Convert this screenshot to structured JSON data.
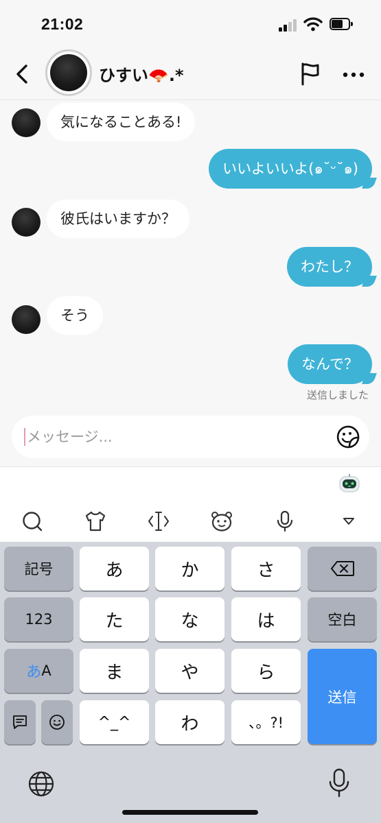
{
  "status_bar": {
    "time": "21:02",
    "icons": [
      "signal-icon",
      "wifi-icon",
      "battery-icon"
    ]
  },
  "header": {
    "contact_name": "ひすい🪭.*",
    "icons": [
      "back-arrow-icon",
      "avatar",
      "flag-icon",
      "more-icon"
    ]
  },
  "messages": [
    {
      "side": "in",
      "text": "気になることある!"
    },
    {
      "side": "out",
      "text": "いいよいいよ(๑˘ᵕ˘๑)"
    },
    {
      "side": "in",
      "text": "彼氏はいますか？"
    },
    {
      "side": "out",
      "text": "わたし？"
    },
    {
      "side": "in",
      "text": "そう"
    },
    {
      "side": "out",
      "text": "なんで？"
    }
  ],
  "sent_status": "送信しました",
  "input": {
    "placeholder": "メッセージ...",
    "value": ""
  },
  "keyboard_toolbar": {
    "icons": [
      "chat-search-icon",
      "shirt-icon",
      "cursor-move-icon",
      "bear-face-icon",
      "microphone-icon",
      "collapse-triangle-icon",
      "robot-icon"
    ]
  },
  "keyboard": {
    "symbols": "記号",
    "numbers": "123",
    "kana_mode": "あ",
    "alpha_mode": "A",
    "space": "空白",
    "send": "送信",
    "keys": [
      "あ",
      "か",
      "さ",
      "た",
      "な",
      "は",
      "ま",
      "や",
      "ら",
      "^_^",
      "わ",
      "、。?!"
    ],
    "icons": [
      "backspace-icon",
      "message-icon",
      "emoji-icon",
      "globe-icon",
      "dictation-mic-icon"
    ]
  },
  "colors": {
    "outgoing_bubble": "#3fb3d6",
    "send_key": "#3d8ff3",
    "caret": "#e79ab0"
  }
}
